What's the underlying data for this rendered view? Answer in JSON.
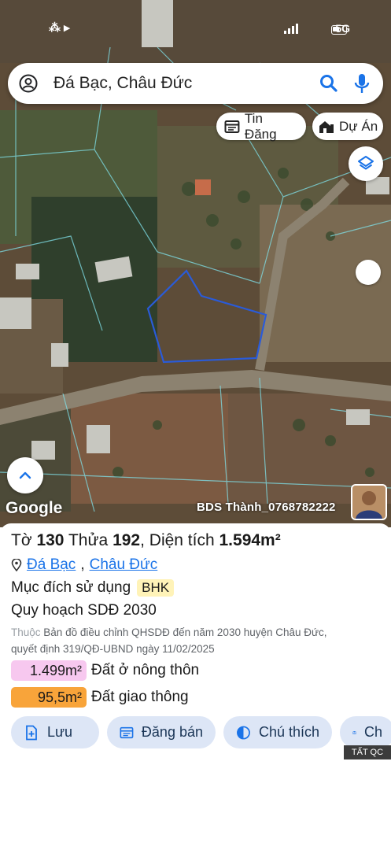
{
  "status_bar": {
    "signal_label": "5G"
  },
  "search": {
    "query": "Đá Bạc, Châu Đức"
  },
  "chips": {
    "tin_dang": "Tin Đăng",
    "du_an": "Dự Án"
  },
  "map": {
    "brand": "Google",
    "watermark": "BDS Thành_0768782222"
  },
  "parcel": {
    "title_prefix_to": "Tờ",
    "to": "130",
    "title_prefix_thua": "Thửa",
    "thua": "192",
    "title_prefix_area": ", Diện tích",
    "area": "1.594m²",
    "commune": "Đá Bạc",
    "district": "Châu Đức",
    "purpose_label": "Mục đích sử dụng",
    "purpose_code": "BHK",
    "plan_label": "Quy hoạch SDĐ 2030",
    "source_prefix": "Thuộc",
    "source_text": "Bản đồ điều chỉnh QHSDĐ đến năm 2030 huyện Châu Đức,",
    "decision": "quyết định 319/QĐ-UBND ngày 11/02/2025",
    "zones": [
      {
        "area": "1.499m²",
        "label": "Đất ở nông thôn",
        "color": "#f7c8ef"
      },
      {
        "area": "95,5m²",
        "label": "Đất giao thông",
        "color": "#f8a43a"
      }
    ]
  },
  "actions": {
    "save": "Lưu",
    "sell": "Đăng bán",
    "legend": "Chú thích",
    "more": "Ch"
  },
  "ad_label": "TẤT QC",
  "colors": {
    "accent": "#1a73e8",
    "button_bg": "#dde6f6",
    "parcel_outline": "#2a5bd8"
  }
}
